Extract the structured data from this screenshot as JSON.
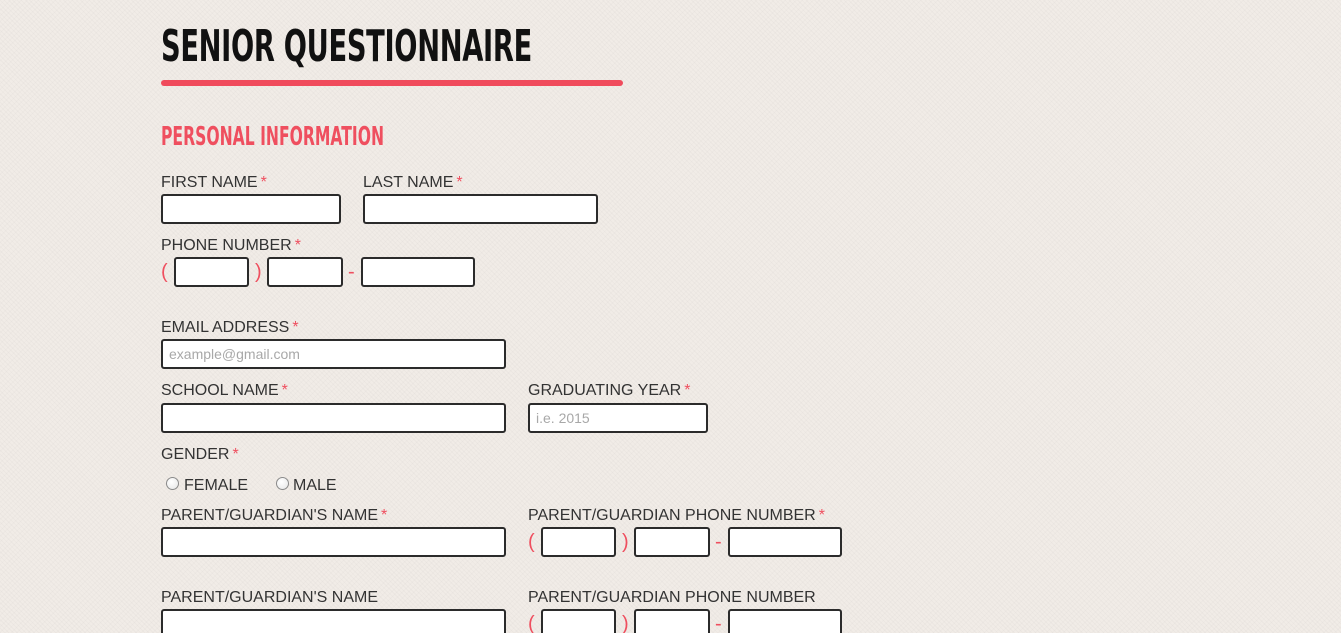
{
  "page": {
    "title": "SENIOR QUESTIONNAIRE",
    "section_title": "PERSONAL INFORMATION"
  },
  "form": {
    "required_mark": "*",
    "phone_open": "(",
    "phone_close": ")",
    "phone_dash": "-",
    "first_name": {
      "label": "FIRST NAME",
      "value": ""
    },
    "last_name": {
      "label": "LAST NAME",
      "value": ""
    },
    "phone_number": {
      "label": "PHONE NUMBER"
    },
    "email": {
      "label": "EMAIL ADDRESS",
      "placeholder": "example@gmail.com"
    },
    "school_name": {
      "label": "SCHOOL NAME"
    },
    "graduating_year": {
      "label": "GRADUATING YEAR",
      "placeholder": "i.e. 2015"
    },
    "gender": {
      "label": "GENDER",
      "options": [
        "FEMALE",
        "MALE"
      ],
      "selected": ""
    },
    "parent1_name": {
      "label": "PARENT/GUARDIAN'S NAME"
    },
    "parent1_phone": {
      "label": "PARENT/GUARDIAN PHONE NUMBER"
    },
    "parent2_name": {
      "label": "PARENT/GUARDIAN'S NAME"
    },
    "parent2_phone": {
      "label": "PARENT/GUARDIAN PHONE NUMBER"
    }
  },
  "colors": {
    "accent": "#f04b5c",
    "background": "#f1ece7",
    "field_border": "#2b2b2b"
  }
}
